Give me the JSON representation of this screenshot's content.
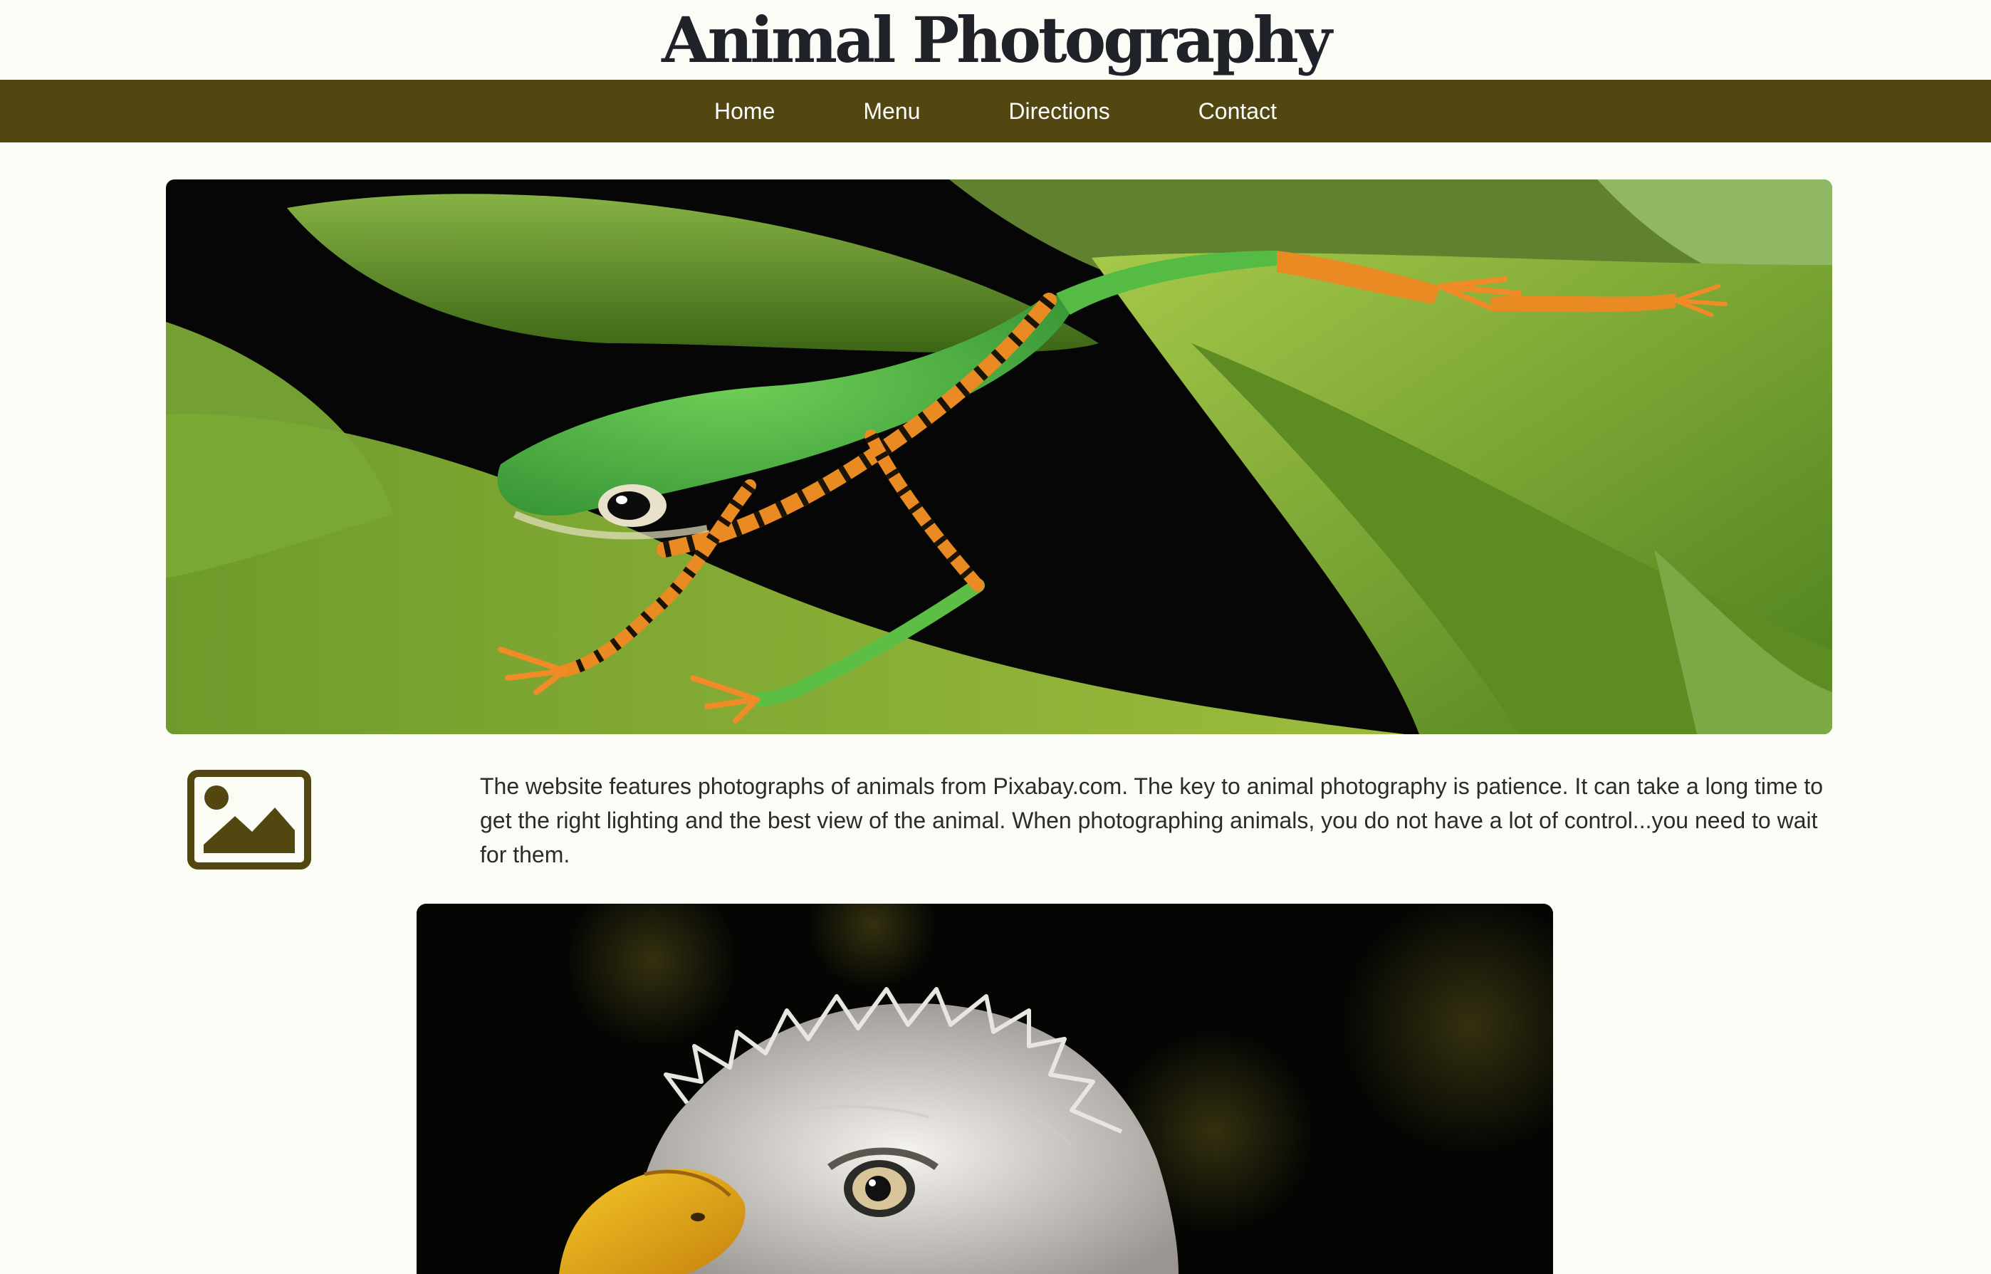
{
  "site": {
    "title": "Animal Photography"
  },
  "nav": {
    "items": [
      {
        "label": "Home"
      },
      {
        "label": "Menu"
      },
      {
        "label": "Directions"
      },
      {
        "label": "Contact"
      }
    ]
  },
  "main": {
    "hero_alt": "frog",
    "intro_icon": "image-icon",
    "intro_text": "The website features photographs of animals from Pixabay.com. The key to animal photography is patience. It can take a long time to get the right lighting and the best view of the animal. When photographing animals, you do not have a lot of control...you need to wait for them.",
    "second_image_alt": "eagle"
  },
  "colors": {
    "background": "#fcfcf7",
    "nav_bar": "#524711",
    "nav_text": "#ffffff",
    "title": "#1f2329",
    "icon": "#524711"
  }
}
